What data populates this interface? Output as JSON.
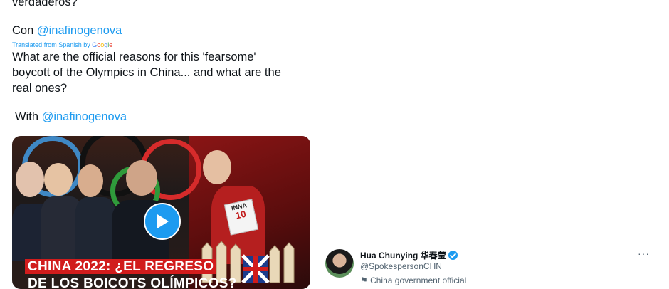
{
  "tweet": {
    "original_tail": "verdaderos?",
    "original_with_prefix": "Con ",
    "original_mention": "@inafinogenova",
    "translated_by": "Translated from Spanish by",
    "google": [
      "G",
      "o",
      "o",
      "g",
      "l",
      "e"
    ],
    "translation_line1": "What are the official reasons for this 'fearsome'",
    "translation_line2": "boycott of the Olympics in China... and what are the",
    "translation_line3": "real ones?",
    "translation_with_prefix": "With ",
    "translation_mention": "@inafinogenova"
  },
  "media": {
    "caption_line1": "CHINA 2022: ¿EL REGRESO",
    "caption_line2": "DE LOS BOICOTS OLÍMPICOS?",
    "bib_name": "INNA",
    "bib_number": "10",
    "play_icon": "play-icon"
  },
  "quoted_account": {
    "display_name": "Hua Chunying 华春莹",
    "handle": "@SpokespersonCHN",
    "affiliation": "China government official",
    "more_label": "···"
  },
  "colors": {
    "link": "#1d9bf0",
    "verified": "#1d9bf0",
    "secondary_text": "#536471"
  }
}
